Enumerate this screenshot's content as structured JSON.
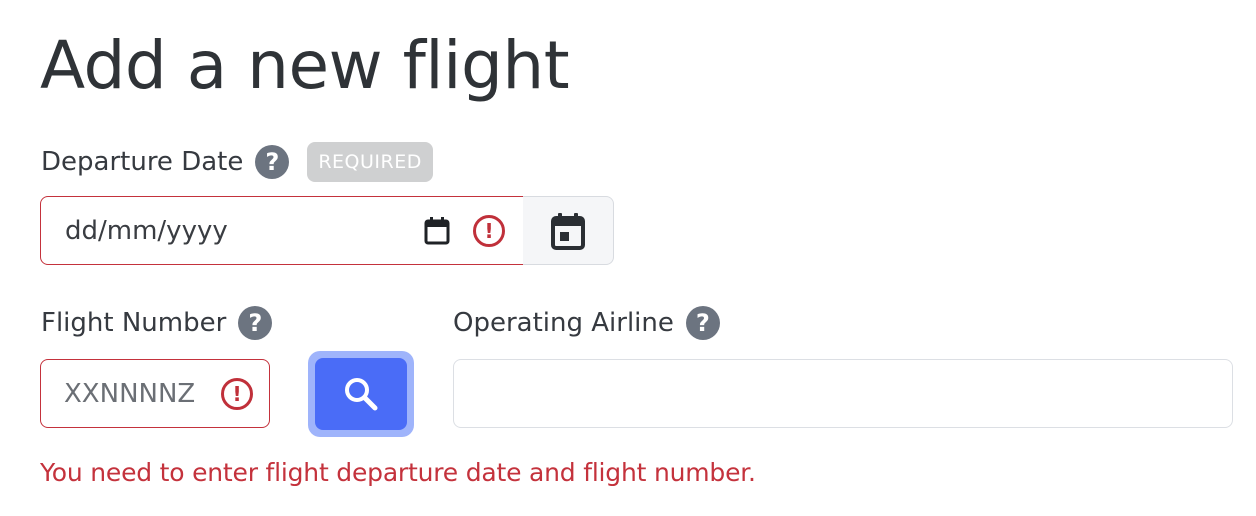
{
  "page_title": "Add a new flight",
  "departure_date": {
    "label": "Departure Date",
    "badge": "REQUIRED",
    "placeholder": "dd/mm/yyyy",
    "help_icon": "question-circle-icon",
    "error_icon": "alert-circle-icon",
    "addon_icon": "calendar-icon"
  },
  "flight_number": {
    "label": "Flight Number",
    "placeholder": "XXNNNNZ",
    "help_icon": "question-circle-icon",
    "error_icon": "alert-circle-icon",
    "search_icon": "search-icon"
  },
  "operating_airline": {
    "label": "Operating Airline",
    "value": "",
    "help_icon": "question-circle-icon"
  },
  "help_glyph": "?",
  "error_glyph": "!",
  "error_message": "You need to enter flight departure date and flight number.",
  "colors": {
    "error": "#c4323c",
    "primary_button": "#4a6cf7",
    "help_icon_bg": "#6c7480",
    "badge_bg": "#cfd0d1"
  }
}
